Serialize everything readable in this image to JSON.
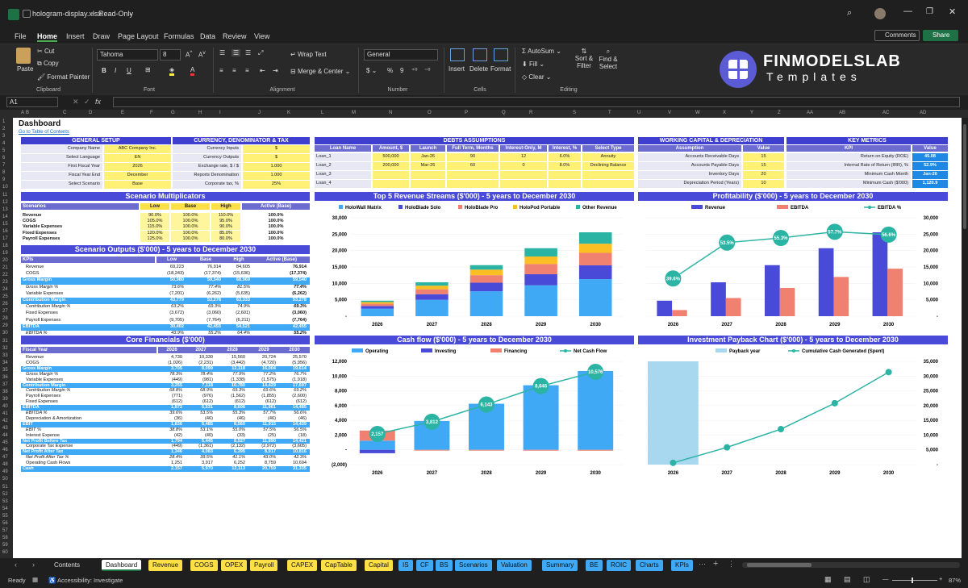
{
  "window": {
    "filename": "hologram-display.xlsx",
    "mode": "Read-Only"
  },
  "menu": [
    "File",
    "Home",
    "Insert",
    "Draw",
    "Page Layout",
    "Formulas",
    "Data",
    "Review",
    "View"
  ],
  "actions": {
    "comments": "Comments",
    "share": "Share"
  },
  "ribbon": {
    "paste": "Paste",
    "cut": "Cut",
    "copy": "Copy",
    "format_painter": "Format Painter",
    "clipboard": "Clipboard",
    "font_name": "Tahoma",
    "font_size": "8",
    "font_group": "Font",
    "wrap_text": "Wrap Text",
    "merge_center": "Merge & Center",
    "alignment_group": "Alignment",
    "number_format": "General",
    "number_group": "Number",
    "insert": "Insert",
    "delete": "Delete",
    "format": "Format",
    "cells_group": "Cells",
    "autosum": "AutoSum",
    "fill": "Fill",
    "clear": "Clear",
    "sort_filter": "Sort & Filter",
    "find_select": "Find & Select",
    "editing_group": "Editing"
  },
  "brand": {
    "name": "FINMODELSLAB",
    "sub": "Templates"
  },
  "formula_bar": {
    "cell_ref": "A1",
    "fx": "fx"
  },
  "columns": [
    "A",
    "B",
    "C",
    "D",
    "E",
    "F",
    "G",
    "H",
    "I",
    "J",
    "K",
    "L",
    "M",
    "N",
    "O",
    "P",
    "Q",
    "R",
    "S",
    "T",
    "U",
    "V",
    "W",
    "X",
    "Y",
    "Z",
    "AA",
    "AB",
    "AC",
    "AD"
  ],
  "dashboard": {
    "title": "Dashboard",
    "toc_link": "Go to Table of Contents",
    "general": {
      "header": "GENERAL SETUP",
      "rows": [
        [
          "Company Name",
          "ABC Company Inc."
        ],
        [
          "Select Language",
          "EN"
        ],
        [
          "First Fiscal Year",
          "2026"
        ],
        [
          "Fiscal Year End",
          "December"
        ],
        [
          "Select Scenario",
          "Base"
        ]
      ]
    },
    "currency": {
      "header": "CURRENCY, DENOMINATOR & TAX",
      "rows": [
        [
          "Currency Inputs",
          "$"
        ],
        [
          "Currency Outputs",
          "$"
        ],
        [
          "Exchange rate, $ / $",
          "1.000"
        ],
        [
          "Reports Denomination",
          "1.000"
        ],
        [
          "Corporate tax, %",
          "25%"
        ]
      ]
    },
    "debts": {
      "header": "DEBTS ASSUMPTIONS",
      "cols": [
        "Loan Name",
        "Amount, $",
        "Launch",
        "Full Term, Months",
        "Interest-Only, M",
        "Interest, %",
        "Select Type"
      ],
      "rows": [
        [
          "Loan_1",
          "500,000",
          "Jan-26",
          "90",
          "12",
          "6.0%",
          "Annuity"
        ],
        [
          "Loan_2",
          "200,000",
          "Mar-26",
          "60",
          "0",
          "8.0%",
          "Declining Balance"
        ],
        [
          "Loan_3",
          "",
          "",
          "",
          "",
          "",
          ""
        ],
        [
          "Loan_4",
          "",
          "",
          "",
          "",
          "",
          ""
        ]
      ]
    },
    "wc": {
      "header": "WORKING CAPITAL & DEPRECIATION",
      "cols": [
        "Assumption",
        "Value"
      ],
      "rows": [
        [
          "Accounts Receivable Days",
          "15"
        ],
        [
          "Accounts Payable Days",
          "15"
        ],
        [
          "Inventory Days",
          "20"
        ],
        [
          "Depreciation Period (Years)",
          "10"
        ]
      ]
    },
    "kpi": {
      "header": "KEY METRICS",
      "cols": [
        "KPI",
        "Value"
      ],
      "rows": [
        [
          "Return on Equity (ROE)",
          "45.08"
        ],
        [
          "Internal Rate of Return (IRR), %",
          "52.9%"
        ],
        [
          "Minimum Cash Month",
          "Jan-26"
        ],
        [
          "Minimum Cash ($'000)",
          "1,120.9"
        ]
      ]
    },
    "multipliers": {
      "header": "Scenario Multiplicators",
      "cols": [
        "Scenarios",
        "Low",
        "Base",
        "High",
        "Active (Base)"
      ],
      "rows": [
        [
          "Revenue",
          "90.0%",
          "100.0%",
          "110.0%",
          "100.0%"
        ],
        [
          "COGS",
          "105.0%",
          "100.0%",
          "95.0%",
          "100.0%"
        ],
        [
          "Variable Expenses",
          "115.0%",
          "100.0%",
          "90.0%",
          "100.0%"
        ],
        [
          "Fixed Expenses",
          "120.0%",
          "100.0%",
          "85.0%",
          "100.0%"
        ],
        [
          "Payroll Expenses",
          "125.0%",
          "100.0%",
          "80.0%",
          "100.0%"
        ]
      ]
    },
    "outputs": {
      "header": "Scenario Outputs ($'000) - 5 years to December 2030",
      "cols": [
        "KPIs",
        "Low",
        "Base",
        "High",
        "Active (Base)"
      ],
      "rows": [
        {
          "l": "Revenue",
          "v": [
            "69,223",
            "76,914",
            "84,605",
            "76,914"
          ],
          "s": "n"
        },
        {
          "l": "COGS",
          "v": [
            "(18,243)",
            "(17,374)",
            "(15,636)",
            "(17,374)"
          ],
          "s": "n"
        },
        {
          "l": "Gross Margin",
          "v": [
            "50,980",
            "59,540",
            "68,969",
            "59,540"
          ],
          "s": "h"
        },
        {
          "l": "Gross Margin %",
          "v": [
            "73.6%",
            "77.4%",
            "81.5%",
            "77.4%"
          ],
          "s": "i"
        },
        {
          "l": "Variable Expenses",
          "v": [
            "(7,201)",
            "(6,262)",
            "(5,635)",
            "(6,262)"
          ],
          "s": "n"
        },
        {
          "l": "Contribution Margin",
          "v": [
            "43,779",
            "53,278",
            "63,333",
            "53,278"
          ],
          "s": "h"
        },
        {
          "l": "Contribution Margin %",
          "v": [
            "63.2%",
            "69.3%",
            "74.9%",
            "69.3%"
          ],
          "s": "i"
        },
        {
          "l": "Fixed Expenses",
          "v": [
            "(3,672)",
            "(3,060)",
            "(2,601)",
            "(3,060)"
          ],
          "s": "n"
        },
        {
          "l": "Payroll Expenses",
          "v": [
            "(9,705)",
            "(7,764)",
            "(6,211)",
            "(7,764)"
          ],
          "s": "n"
        },
        {
          "l": "EBITDA",
          "v": [
            "30,402",
            "42,455",
            "54,521",
            "42,455"
          ],
          "s": "h"
        },
        {
          "l": "EBITDA %",
          "v": [
            "43.9%",
            "55.2%",
            "64.4%",
            "55.2%"
          ],
          "s": "i"
        }
      ]
    },
    "core": {
      "header": "Core Financials ($'000)",
      "cols": [
        "Fiscal Year",
        "2026",
        "2027",
        "2028",
        "2029",
        "2030"
      ],
      "rows": [
        {
          "l": "Revenue",
          "v": [
            "4,730",
            "10,330",
            "15,560",
            "20,724",
            "25,570"
          ],
          "s": "n"
        },
        {
          "l": "COGS",
          "v": [
            "(1,026)",
            "(2,231)",
            "(3,442)",
            "(4,720)",
            "(5,956)"
          ],
          "s": "n"
        },
        {
          "l": "Gross Margin",
          "v": [
            "3,705",
            "8,099",
            "12,118",
            "16,004",
            "19,614"
          ],
          "s": "h"
        },
        {
          "l": "Gross Margin %",
          "v": [
            "78.3%",
            "78.4%",
            "77.9%",
            "77.2%",
            "76.7%"
          ],
          "s": "i"
        },
        {
          "l": "Variable Expenses",
          "v": [
            "(449)",
            "(981)",
            "(1,338)",
            "(1,575)",
            "(1,918)"
          ],
          "s": "n"
        },
        {
          "l": "Contribution Margin",
          "v": [
            "3,255",
            "7,118",
            "10,780",
            "14,429",
            "17,697"
          ],
          "s": "h"
        },
        {
          "l": "Contribution Margin %",
          "v": [
            "68.8%",
            "68.9%",
            "69.3%",
            "69.6%",
            "69.2%"
          ],
          "s": "i"
        },
        {
          "l": "Payroll Expenses",
          "v": [
            "(771)",
            "(976)",
            "(1,562)",
            "(1,855)",
            "(2,600)"
          ],
          "s": "n"
        },
        {
          "l": "Fixed Expenses",
          "v": [
            "(612)",
            "(612)",
            "(612)",
            "(612)",
            "(612)"
          ],
          "s": "n"
        },
        {
          "l": "EBITDA",
          "v": [
            "1,872",
            "5,531",
            "8,606",
            "11,961",
            "14,485"
          ],
          "s": "h"
        },
        {
          "l": "EBITDA %",
          "v": [
            "39.6%",
            "53.5%",
            "55.3%",
            "57.7%",
            "56.6%"
          ],
          "s": "i"
        },
        {
          "l": "Depreciation & Amortization",
          "v": [
            "(36)",
            "(46)",
            "(46)",
            "(46)",
            "(46)"
          ],
          "s": "n"
        },
        {
          "l": "EBIT",
          "v": [
            "1,836",
            "5,485",
            "8,560",
            "11,915",
            "14,439"
          ],
          "s": "h"
        },
        {
          "l": "EBIT %",
          "v": [
            "38.8%",
            "53.1%",
            "55.0%",
            "57.5%",
            "56.5%"
          ],
          "s": "i"
        },
        {
          "l": "Interest Expense",
          "v": [
            "(42)",
            "(40)",
            "(33)",
            "(25)",
            "(18)"
          ],
          "s": "n"
        },
        {
          "l": "Net Profit Before Tax",
          "v": [
            "1,794",
            "5,445",
            "8,527",
            "11,890",
            "14,421"
          ],
          "s": "h"
        },
        {
          "l": "Corporate Tax Expense",
          "v": [
            "(449)",
            "(1,361)",
            "(2,132)",
            "(2,972)",
            "(3,605)"
          ],
          "s": "n"
        },
        {
          "l": "Net Profit After Tax",
          "v": [
            "1,346",
            "4,083",
            "6,395",
            "8,917",
            "10,816"
          ],
          "s": "h"
        },
        {
          "l": "Net Profit After Tax %",
          "v": [
            "28.4%",
            "39.5%",
            "41.1%",
            "43.0%",
            "42.3%"
          ],
          "s": "i"
        },
        {
          "l": "Operating Cash Flows",
          "v": [
            "1,251",
            "3,917",
            "6,252",
            "8,759",
            "10,694"
          ],
          "s": "n"
        },
        {
          "l": "Cash",
          "v": [
            "2,157",
            "5,970",
            "12,113",
            "20,759",
            "31,335"
          ],
          "s": "h"
        }
      ]
    }
  },
  "chart_data": [
    {
      "type": "bar",
      "stacked": true,
      "title": "Top 5 Revenue Streams ($'000) - 5 years to December 2030",
      "categories": [
        "2026",
        "2027",
        "2028",
        "2029",
        "2030"
      ],
      "series": [
        {
          "name": "HoloWall Matrix",
          "color": "#3fa9f5",
          "values": [
            2300,
            5000,
            7600,
            9400,
            11300
          ]
        },
        {
          "name": "HoloBlade Solo",
          "color": "#4a4ad8",
          "values": [
            800,
            1700,
            2600,
            3400,
            4200
          ]
        },
        {
          "name": "HoloBlade Pro",
          "color": "#f08070",
          "values": [
            700,
            1500,
            2300,
            3100,
            3800
          ]
        },
        {
          "name": "HoloPod Portable",
          "color": "#fbbf24",
          "values": [
            500,
            1100,
            1700,
            2300,
            2800
          ]
        },
        {
          "name": "Other Revenue",
          "color": "#2bb3a3",
          "values": [
            430,
            1030,
            1360,
            2524,
            3470
          ]
        }
      ],
      "ylim": [
        0,
        30000
      ],
      "yticks": [
        "-",
        "5,000",
        "10,000",
        "15,000",
        "20,000",
        "25,000",
        "30,000"
      ]
    },
    {
      "type": "bar+line",
      "title": "Profitability ($'000) - 5 years to December 2030",
      "categories": [
        "2026",
        "2027",
        "2028",
        "2029",
        "2030"
      ],
      "series": [
        {
          "name": "Revenue",
          "color": "#4a4ad8",
          "values": [
            4730,
            10330,
            15560,
            20724,
            25570
          ]
        },
        {
          "name": "EBITDA",
          "color": "#f08070",
          "values": [
            1872,
            5531,
            8606,
            11961,
            14485
          ]
        },
        {
          "name": "EBITDA %",
          "color": "#2bb3a3",
          "values": [
            39.6,
            53.5,
            55.3,
            57.7,
            56.6
          ],
          "labels": [
            "39.6%",
            "53.5%",
            "55.3%",
            "57.7%",
            "56.6%"
          ]
        }
      ],
      "ylim": [
        0,
        30000
      ],
      "yticks": [
        "-",
        "5,000",
        "10,000",
        "15,000",
        "20,000",
        "25,000",
        "30,000"
      ]
    },
    {
      "type": "bar+line",
      "title": "Cash flow ($'000) - 5 years to December 2030",
      "categories": [
        "2026",
        "2027",
        "2028",
        "2029",
        "2030"
      ],
      "series": [
        {
          "name": "Operating",
          "color": "#3fa9f5",
          "values": [
            1251,
            3917,
            6252,
            8759,
            10694
          ]
        },
        {
          "name": "Investing",
          "color": "#4a4ad8",
          "values": [
            -460,
            0,
            0,
            0,
            0
          ]
        },
        {
          "name": "Financing",
          "color": "#f08070",
          "values": [
            1366,
            -104,
            -109,
            -113,
            -118
          ]
        },
        {
          "name": "Net Cash Flow",
          "color": "#2bb3a3",
          "values": [
            2157,
            3812,
            6143,
            8646,
            10576
          ],
          "labels": [
            "2,157",
            "3,812",
            "6,143",
            "8,646",
            "10,576"
          ]
        }
      ],
      "ylim": [
        -2000,
        12000
      ],
      "yticks": [
        "(2,000)",
        "-",
        "2,000",
        "4,000",
        "6,000",
        "8,000",
        "10,000",
        "12,000"
      ]
    },
    {
      "type": "bar+line",
      "title": "Investment Payback Chart ($'000) - 5 years to December 2030",
      "categories": [
        "2026",
        "2027",
        "2028",
        "2029",
        "2030"
      ],
      "series": [
        {
          "name": "Payback year",
          "color": "#a8d8f0",
          "values": [
            1,
            0,
            0,
            0,
            0
          ]
        },
        {
          "name": "Cumulative Cash Generated (Spent)",
          "color": "#2bb3a3",
          "values": [
            197,
            1948,
            4007,
            6938,
            10450
          ]
        }
      ],
      "ylim": [
        0,
        35000
      ],
      "yticks": [
        "-",
        "5,000",
        "10,000",
        "15,000",
        "20,000",
        "25,000",
        "30,000",
        "35,000"
      ]
    }
  ],
  "tabs": [
    {
      "label": "Contents",
      "kind": "plain"
    },
    {
      "label": "Dashboard",
      "kind": "active"
    },
    {
      "label": "Revenue",
      "kind": "y"
    },
    {
      "label": "COGS",
      "kind": "y"
    },
    {
      "label": "OPEX",
      "kind": "y"
    },
    {
      "label": "Payroll",
      "kind": "y"
    },
    {
      "label": "CAPEX",
      "kind": "y"
    },
    {
      "label": "CapTable",
      "kind": "y"
    },
    {
      "label": "Capital",
      "kind": "y"
    },
    {
      "label": "IS",
      "kind": "b"
    },
    {
      "label": "CF",
      "kind": "b"
    },
    {
      "label": "BS",
      "kind": "b"
    },
    {
      "label": "Scenarios",
      "kind": "b"
    },
    {
      "label": "Valuation",
      "kind": "b"
    },
    {
      "label": "Summary",
      "kind": "b"
    },
    {
      "label": "BE",
      "kind": "b"
    },
    {
      "label": "ROIC",
      "kind": "b"
    },
    {
      "label": "Charts",
      "kind": "b"
    },
    {
      "label": "KPIs",
      "kind": "b"
    }
  ],
  "status": {
    "ready": "Ready",
    "accessibility": "Accessibility: Investigate",
    "zoom": "87%"
  }
}
